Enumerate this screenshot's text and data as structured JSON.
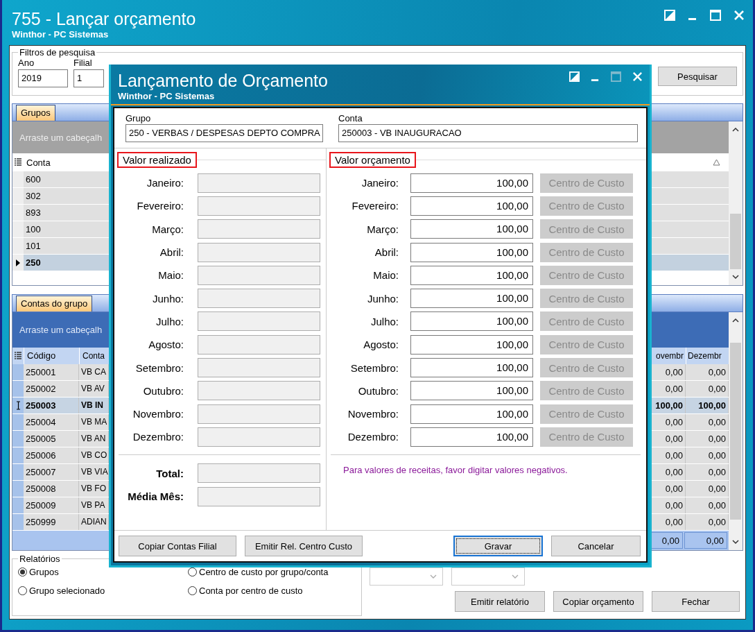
{
  "window": {
    "title": "755 - Lançar orçamento",
    "subtitle": "Winthor - PC Sistemas"
  },
  "filters": {
    "legend": "Filtros de pesquisa",
    "fields": [
      {
        "label": "Ano",
        "value": "2019"
      },
      {
        "label": "Filial",
        "value": "1"
      }
    ],
    "search_button": "Pesquisar"
  },
  "groups": {
    "tabs": [
      {
        "label": "Grupos",
        "selected": true
      }
    ],
    "drag_hint": "Arraste um cabeçalh",
    "columns": [
      "Conta"
    ],
    "rows": [
      {
        "cells": [
          "600"
        ],
        "selected": false
      },
      {
        "cells": [
          "302"
        ],
        "selected": false
      },
      {
        "cells": [
          "893"
        ],
        "selected": false
      },
      {
        "cells": [
          "100"
        ],
        "selected": false
      },
      {
        "cells": [
          "101"
        ],
        "selected": false
      },
      {
        "cells": [
          "250"
        ],
        "selected": true
      }
    ]
  },
  "accounts": {
    "tabs": [
      {
        "label": "Contas do grupo",
        "selected": true
      }
    ],
    "drag_hint": "Arraste um cabeçalh",
    "columns": [
      "Código",
      "Conta",
      "ovembr",
      "Dezembr"
    ],
    "rows": [
      {
        "cells": [
          "250001",
          "VB CA",
          "0,00",
          "0,00"
        ],
        "selected": false
      },
      {
        "cells": [
          "250002",
          "VB AV",
          "0,00",
          "0,00"
        ],
        "selected": false
      },
      {
        "cells": [
          "250003",
          "VB IN",
          "100,00",
          "100,00"
        ],
        "selected": true
      },
      {
        "cells": [
          "250004",
          "VB MA",
          "0,00",
          "0,00"
        ],
        "selected": false
      },
      {
        "cells": [
          "250005",
          "VB AN",
          "0,00",
          "0,00"
        ],
        "selected": false
      },
      {
        "cells": [
          "250006",
          "VB CO",
          "0,00",
          "0,00"
        ],
        "selected": false
      },
      {
        "cells": [
          "250007",
          "VB VIA",
          "0,00",
          "0,00"
        ],
        "selected": false
      },
      {
        "cells": [
          "250008",
          "VB FO",
          "0,00",
          "0,00"
        ],
        "selected": false
      },
      {
        "cells": [
          "250009",
          "VB PA",
          "0,00",
          "0,00"
        ],
        "selected": false
      },
      {
        "cells": [
          "250999",
          "ADIAN",
          "0,00",
          "0,00"
        ],
        "selected": false
      }
    ],
    "totals": [
      "0,00",
      "0,00"
    ]
  },
  "reports": {
    "legend": "Relatórios",
    "options": [
      {
        "label": "Grupos",
        "selected": true
      },
      {
        "label": "Centro de custo por grupo/conta",
        "selected": false
      },
      {
        "label": "Grupo selecionado",
        "selected": false
      },
      {
        "label": "Conta por centro de custo",
        "selected": false
      }
    ],
    "buttons": [
      "Emitir relatório",
      "Copiar orçamento",
      "Fechar"
    ]
  },
  "dialog": {
    "title": "Lançamento de Orçamento",
    "subtitle": "Winthor - PC Sistemas",
    "fields": [
      {
        "label": "Grupo",
        "value": "250 - VERBAS / DESPESAS DEPTO COMPRA"
      },
      {
        "label": "Conta",
        "value": "250003 - VB INAUGURACAO"
      }
    ],
    "realized": {
      "legend": "Valor realizado",
      "highlighted": true,
      "months": [
        "Janeiro:",
        "Fevereiro:",
        "Março:",
        "Abril:",
        "Maio:",
        "Junho:",
        "Julho:",
        "Agosto:",
        "Setembro:",
        "Outubro:",
        "Novembro:",
        "Dezembro:"
      ],
      "totals": [
        "Total:",
        "Média Mês:"
      ]
    },
    "budget": {
      "legend": "Valor orçamento",
      "highlighted": true,
      "months": [
        {
          "label": "Janeiro:",
          "value": "100,00",
          "button": "Centro de Custo",
          "disabled": true
        },
        {
          "label": "Fevereiro:",
          "value": "100,00",
          "button": "Centro de Custo",
          "disabled": true
        },
        {
          "label": "Março:",
          "value": "100,00",
          "button": "Centro de Custo",
          "disabled": true
        },
        {
          "label": "Abril:",
          "value": "100,00",
          "button": "Centro de Custo",
          "disabled": true
        },
        {
          "label": "Maio:",
          "value": "100,00",
          "button": "Centro de Custo",
          "disabled": true
        },
        {
          "label": "Junho:",
          "value": "100,00",
          "button": "Centro de Custo",
          "disabled": true
        },
        {
          "label": "Julho:",
          "value": "100,00",
          "button": "Centro de Custo",
          "disabled": true
        },
        {
          "label": "Agosto:",
          "value": "100,00",
          "button": "Centro de Custo",
          "disabled": true
        },
        {
          "label": "Setembro:",
          "value": "100,00",
          "button": "Centro de Custo",
          "disabled": true
        },
        {
          "label": "Outubro:",
          "value": "100,00",
          "button": "Centro de Custo",
          "disabled": true
        },
        {
          "label": "Novembro:",
          "value": "100,00",
          "button": "Centro de Custo",
          "disabled": true
        },
        {
          "label": "Dezembro:",
          "value": "100,00",
          "button": "Centro de Custo",
          "disabled": true
        }
      ],
      "note": "Para valores de receitas, favor digitar valores negativos."
    },
    "left_buttons": [
      {
        "label": "Copiar Contas Filial",
        "focused": false
      },
      {
        "label": "Emitir Rel. Centro Custo",
        "focused": false
      }
    ],
    "right_buttons": [
      {
        "label": "Gravar",
        "focused": true
      },
      {
        "label": "Cancelar",
        "focused": false
      }
    ]
  }
}
